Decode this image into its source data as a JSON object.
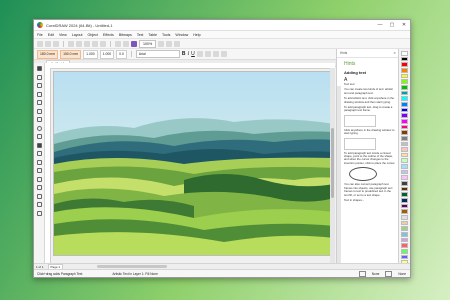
{
  "window": {
    "title": "CorelDRAW 2024 (64-Bit) - Untitled-1",
    "controls": [
      "—",
      "▢",
      "✕"
    ]
  },
  "menubar": {
    "items": [
      "File",
      "Edit",
      "View",
      "Layout",
      "Object",
      "Effects",
      "Bitmaps",
      "Text",
      "Table",
      "Tools",
      "Window",
      "Help"
    ]
  },
  "toolbar": {
    "zoom": "100%"
  },
  "propbar": {
    "x": "180.0 mm",
    "y": "150.0 mm",
    "w": "1.000",
    "h": "1.000",
    "angle": "0.0",
    "font": "Arial",
    "bold": "B",
    "italic": "I",
    "underline": "U"
  },
  "document_tab": {
    "label": "Untitled-1"
  },
  "docker": {
    "tab_label": "Hints",
    "title": "Hints",
    "section": "Adding text",
    "tool_name": "Text tool",
    "hint1": "You can create two kinds of text: artistic text and paragraph text.",
    "hint2": "To add artistic text, click anywhere in the drawing window and then start typing.",
    "hint3": "To add paragraph text, drag to create a paragraph text frame.",
    "hint4": "Click anywhere in the drawing window to start typing.",
    "hint5": "To add paragraph text inside a closed shape, point to the outline of the shape, and when the cursor changes to the insertion pointer, click to place the cursor.",
    "hint6": "You can also convert paragraph text frames into objects, use paragraph text frames to text to predefined text in the text fill, or set to a text shape.",
    "hint7": "Text in shapes..."
  },
  "bottombar": {
    "page_nav": "1 of 1",
    "page_tab": "Page 1"
  },
  "statusbar": {
    "left": "Click+drag adds Paragraph Text",
    "mid": "Artistic Text in Layer 1: Fill None",
    "fill_label": "None",
    "outline_label": "None"
  },
  "colors": {
    "accent": "#7b57b8",
    "hints_green": "#5c9e3f"
  },
  "palette": [
    "#ffffff",
    "#000000",
    "#ff0000",
    "#ff8000",
    "#ffff00",
    "#80ff00",
    "#00c000",
    "#00a0a0",
    "#00ffff",
    "#0080ff",
    "#0000ff",
    "#8000ff",
    "#ff00ff",
    "#ff0080",
    "#804000",
    "#808080",
    "#c0c0c0",
    "#ffc0c0",
    "#ffe0a0",
    "#c0ffc0",
    "#a0e0ff",
    "#c0c0ff",
    "#ffc0ff",
    "#404040",
    "#603000",
    "#006030",
    "#003060",
    "#600060",
    "#a06000",
    "#e0e0e0",
    "#f0d0a0",
    "#a0d080",
    "#80c0e0",
    "#d0a0e0",
    "#ff6060",
    "#60ff60",
    "#6060ff",
    "#ffff80"
  ]
}
